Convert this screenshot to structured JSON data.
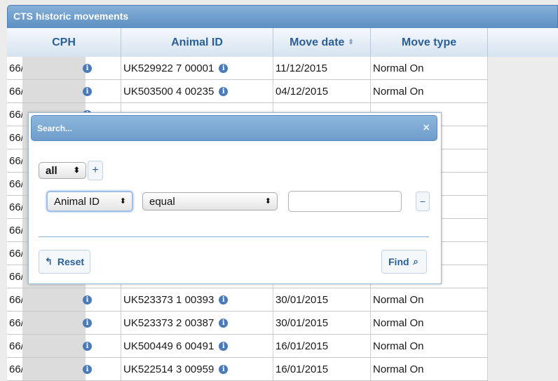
{
  "panel": {
    "title": "CTS historic movements"
  },
  "grid": {
    "columns": [
      "CPH",
      "Animal ID",
      "Move date",
      "Move type"
    ],
    "sort_indicator": "⬍",
    "rows": [
      {
        "cph": "66/(",
        "animal_id": "UK529922 7 00001",
        "move_date": "11/12/2015",
        "move_type": "Normal On"
      },
      {
        "cph": "66/(",
        "animal_id": "UK503500 4 00235",
        "move_date": "04/12/2015",
        "move_type": "Normal On"
      },
      {
        "cph": "66/(",
        "animal_id": "",
        "move_date": "",
        "move_type": ""
      },
      {
        "cph": "66/(",
        "animal_id": "",
        "move_date": "",
        "move_type": ""
      },
      {
        "cph": "66/(",
        "animal_id": "",
        "move_date": "",
        "move_type": ""
      },
      {
        "cph": "66/(",
        "animal_id": "",
        "move_date": "",
        "move_type": ""
      },
      {
        "cph": "66/(",
        "animal_id": "",
        "move_date": "",
        "move_type": ""
      },
      {
        "cph": "66/(",
        "animal_id": "",
        "move_date": "",
        "move_type": ""
      },
      {
        "cph": "66/(",
        "animal_id": "",
        "move_date": "",
        "move_type": ""
      },
      {
        "cph": "66/(",
        "animal_id": "",
        "move_date": "",
        "move_type": ""
      },
      {
        "cph": "66/",
        "animal_id": "UK523373 1 00393",
        "move_date": "30/01/2015",
        "move_type": "Normal On"
      },
      {
        "cph": "66/",
        "animal_id": "UK523373 2 00387",
        "move_date": "30/01/2015",
        "move_type": "Normal On"
      },
      {
        "cph": "66/",
        "animal_id": "UK500449 6 00491",
        "move_date": "16/01/2015",
        "move_type": "Normal On"
      },
      {
        "cph": "66/",
        "animal_id": "UK522514 3 00959",
        "move_date": "16/01/2015",
        "move_type": "Normal On"
      }
    ]
  },
  "dialog": {
    "title": "Search...",
    "close_glyph": "×",
    "group_op": "all",
    "add_glyph": "+",
    "field": "Animal ID",
    "operator": "equal",
    "value": "",
    "remove_glyph": "−",
    "reset_label": "Reset",
    "reset_icon": "↰",
    "find_label": "Find",
    "find_icon": "⌕",
    "select_arrows": "⬍"
  },
  "icons": {
    "info": "i"
  },
  "colors": {
    "header_blue": "#5d8fc2",
    "link_blue": "#2a5f96",
    "info_icon": "#4a7ab8"
  }
}
